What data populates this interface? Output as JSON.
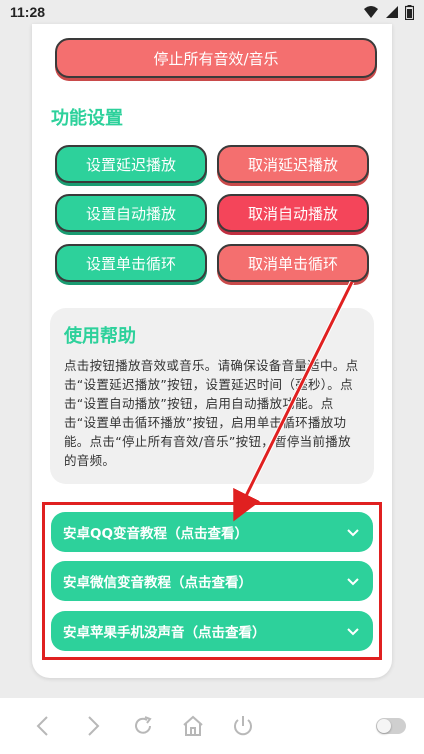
{
  "status": {
    "time": "11:28"
  },
  "top_button": {
    "label": "停止所有音效/音乐"
  },
  "section": {
    "title": "功能设置"
  },
  "buttons": {
    "set_delay": "设置延迟播放",
    "cancel_delay": "取消延迟播放",
    "set_auto": "设置自动播放",
    "cancel_auto": "取消自动播放",
    "set_loop": "设置单击循环",
    "cancel_loop": "取消单击循环"
  },
  "help": {
    "title": "使用帮助",
    "text": "点击按钮播放音效或音乐。请确保设备音量适中。点击“设置延迟播放”按钮，设置延迟时间（毫秒）。点击“设置自动播放”按钮，启用自动播放功能。点击“设置单击循环播放”按钮，启用单击循环播放功能。点击“停止所有音效/音乐”按钮，暂停当前播放的音频。"
  },
  "accordions": [
    {
      "label": "安卓QQ变音教程（点击查看）"
    },
    {
      "label": "安卓微信变音教程（点击查看）"
    },
    {
      "label": "安卓苹果手机没声音（点击查看）"
    }
  ],
  "colors": {
    "accent": "#2dd19b",
    "danger": "#f46f6f",
    "highlight": "#e02020"
  },
  "nav_icons": [
    "back-icon",
    "forward-icon",
    "refresh-icon",
    "home-icon",
    "power-icon",
    "toggle-switch"
  ]
}
